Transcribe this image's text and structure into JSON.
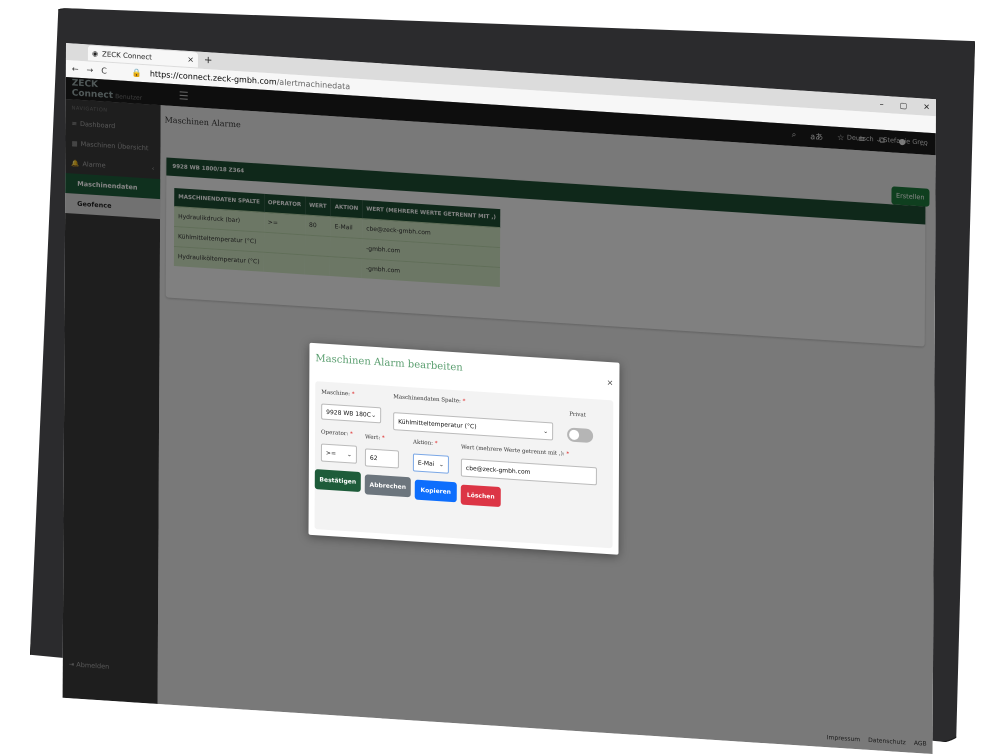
{
  "browser": {
    "tab_title": "ZECK Connect",
    "tab_close": "×",
    "new_tab": "+",
    "url_host": "https://connect.zeck-gmbh.com",
    "url_path": "/alertmachinedata",
    "win_min": "–",
    "win_max": "▢",
    "win_close": "✕",
    "nav_back": "←",
    "nav_forward": "→",
    "nav_reload": "C",
    "lock": "🔒"
  },
  "app": {
    "brand": "ZECK Connect",
    "brand_sub": "Benutzer",
    "hamburger": "☰",
    "language": "Deutsch",
    "user": "Stefanie Greo"
  },
  "sidebar": {
    "section": "NAVIGATION",
    "items": [
      {
        "label": "Dashboard",
        "icon": "≡"
      },
      {
        "label": "Maschinen Übersicht",
        "icon": "▦"
      },
      {
        "label": "Alarme",
        "icon": "🔔",
        "chev": "‹"
      }
    ],
    "sub_items": [
      {
        "label": "Maschinendaten"
      },
      {
        "label": "Geofence"
      }
    ],
    "logout": "Abmelden"
  },
  "page": {
    "title": "Maschinen Alarme",
    "create_button": "Erstellen",
    "card_title": "9928 WB 1800/18 Z364"
  },
  "table": {
    "headers": [
      "MASCHINENDATEN SPALTE",
      "OPERATOR",
      "WERT",
      "AKTION",
      "WERT (MEHRERE WERTE GETRENNT MIT ,)"
    ],
    "rows": [
      [
        "Hydraulikdruck (bar)",
        ">=",
        "80",
        "E-Mail",
        "cbe@zeck-gmbh.com"
      ],
      [
        "Kühlmitteltemperatur (°C)",
        "",
        "",
        "",
        "-gmbh.com"
      ],
      [
        "Hydrauliköltemperatur (°C)",
        "",
        "",
        "",
        "-gmbh.com"
      ]
    ]
  },
  "modal": {
    "title": "Maschinen Alarm bearbeiten",
    "close": "×",
    "machine_label": "Maschine:",
    "machine_value": "9928 WB 180C",
    "column_label": "Maschinendaten Spalte:",
    "column_value": "Kühlmitteltemperatur (°C)",
    "private_label": "Privat",
    "operator_label": "Operator:",
    "operator_value": ">=",
    "value_label": "Wert:",
    "value_value": "62",
    "action_label": "Aktion:",
    "action_value": "E-Mai",
    "multi_label": "Wert (mehrere Werte getrennt mit ,):",
    "multi_value": "cbe@zeck-gmbh.com",
    "req": "*",
    "btn_confirm": "Bestätigen",
    "btn_cancel": "Abbrechen",
    "btn_copy": "Kopieren",
    "btn_delete": "Löschen",
    "colors": {
      "confirm": "#1e5c3a",
      "cancel": "#6c757d",
      "copy": "#0d6efd",
      "delete": "#dc3545"
    }
  },
  "footer": {
    "impressum": "Impressum",
    "datenschutz": "Datenschutz",
    "agb": "AGB"
  }
}
